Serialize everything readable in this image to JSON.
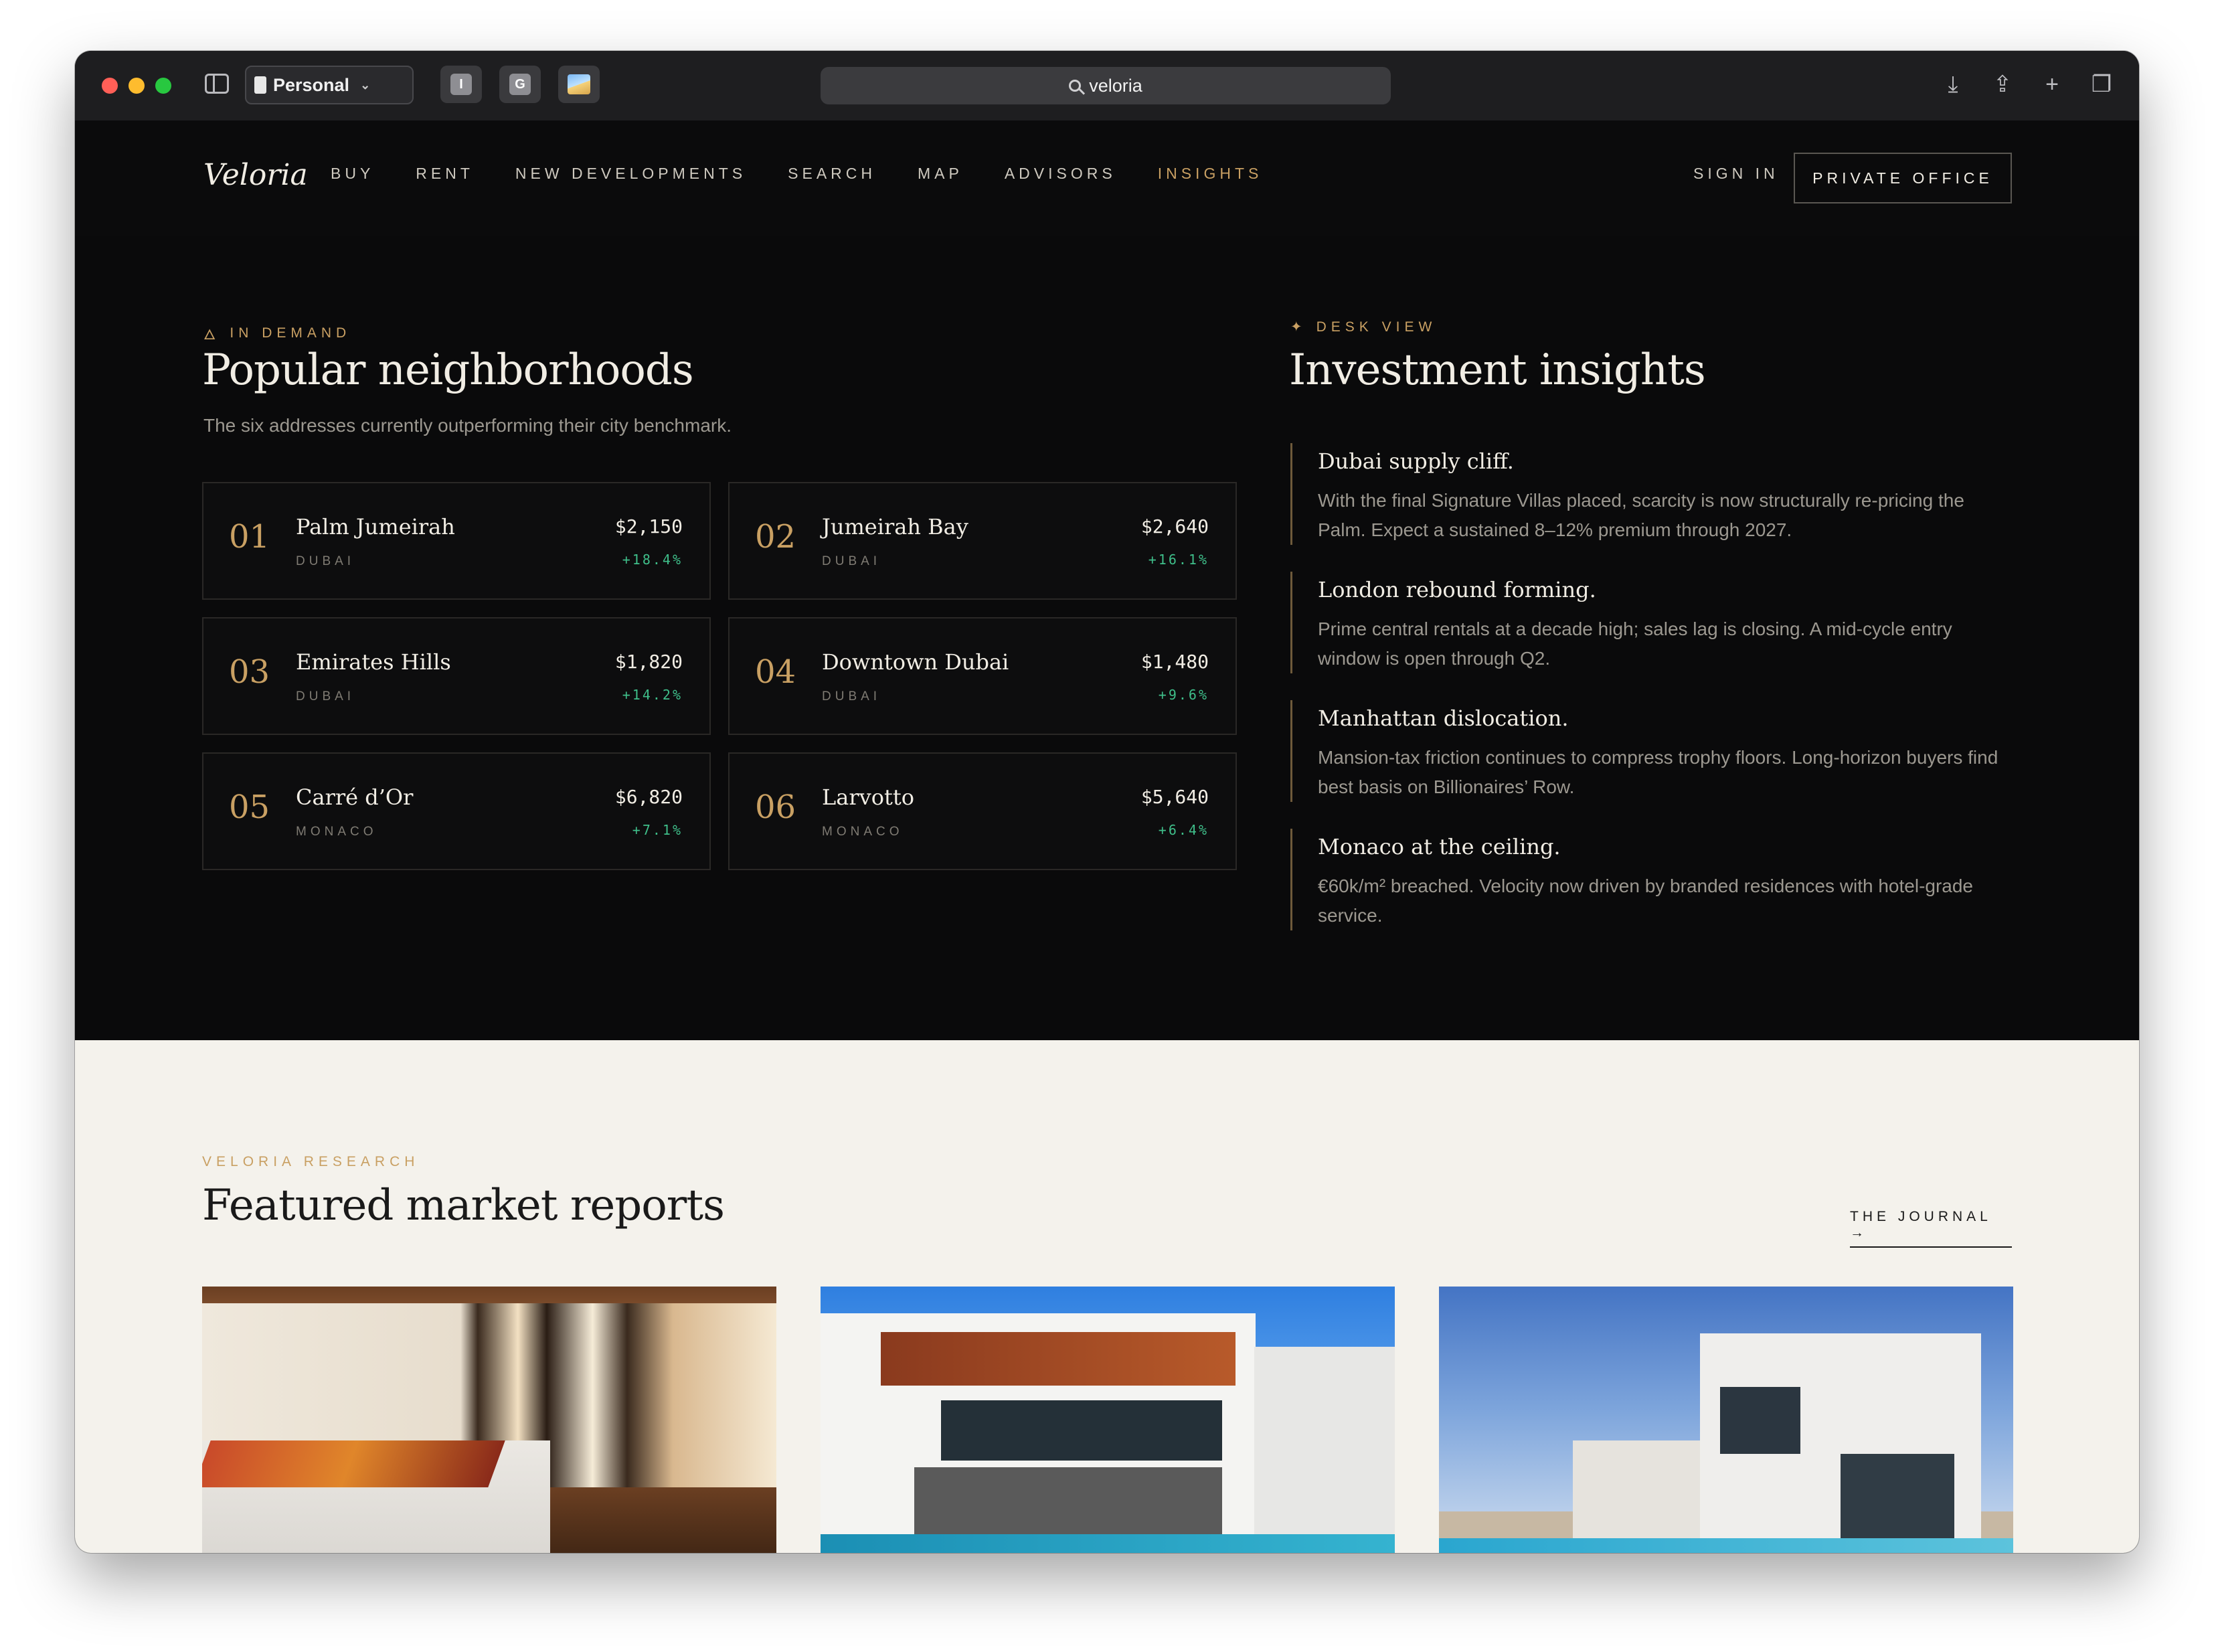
{
  "browser": {
    "profile": "Personal",
    "tabs": [
      {
        "label": "I"
      },
      {
        "label": "G"
      },
      {
        "label": ""
      }
    ],
    "url": "veloria"
  },
  "header": {
    "logo": "Veloria",
    "nav": [
      {
        "label": "BUY"
      },
      {
        "label": "RENT"
      },
      {
        "label": "NEW DEVELOPMENTS"
      },
      {
        "label": "SEARCH"
      },
      {
        "label": "MAP"
      },
      {
        "label": "ADVISORS"
      },
      {
        "label": "INSIGHTS",
        "active": true
      }
    ],
    "sign_in": "SIGN IN",
    "private_office": "PRIVATE OFFICE"
  },
  "neighborhoods": {
    "eyebrow": "IN DEMAND",
    "title": "Popular neighborhoods",
    "subtitle": "The six addresses currently outperforming their city benchmark.",
    "items": [
      {
        "num": "01",
        "name": "Palm Jumeirah",
        "city": "DUBAI",
        "price": "$2,150",
        "change": "+18.4%"
      },
      {
        "num": "02",
        "name": "Jumeirah Bay",
        "city": "DUBAI",
        "price": "$2,640",
        "change": "+16.1%"
      },
      {
        "num": "03",
        "name": "Emirates Hills",
        "city": "DUBAI",
        "price": "$1,820",
        "change": "+14.2%"
      },
      {
        "num": "04",
        "name": "Downtown Dubai",
        "city": "DUBAI",
        "price": "$1,480",
        "change": "+9.6%"
      },
      {
        "num": "05",
        "name": "Carré d’Or",
        "city": "MONACO",
        "price": "$6,820",
        "change": "+7.1%"
      },
      {
        "num": "06",
        "name": "Larvotto",
        "city": "MONACO",
        "price": "$5,640",
        "change": "+6.4%"
      }
    ]
  },
  "insights": {
    "eyebrow": "DESK VIEW",
    "title": "Investment insights",
    "items": [
      {
        "title": "Dubai supply cliff.",
        "body": "With the final Signature Villas placed, scarcity is now structurally re-pricing the Palm. Expect a sustained 8–12% premium through 2027."
      },
      {
        "title": "London rebound forming.",
        "body": "Prime central rentals at a decade high; sales lag is closing. A mid-cycle entry window is open through Q2."
      },
      {
        "title": "Manhattan dislocation.",
        "body": "Mansion-tax friction continues to compress trophy floors. Long-horizon buyers find best basis on Billionaires’ Row."
      },
      {
        "title": "Monaco at the ceiling.",
        "body": "€60k/m² breached. Velocity now driven by branded residences with hotel-grade service."
      }
    ]
  },
  "reports": {
    "eyebrow": "VELORIA RESEARCH",
    "title": "Featured market reports",
    "journal_link": "THE JOURNAL →"
  },
  "colors": {
    "accent": "#c9a063",
    "positive": "#3fbf8a",
    "dark_bg": "#0a0a0b",
    "light_bg": "#f4f2ec"
  }
}
